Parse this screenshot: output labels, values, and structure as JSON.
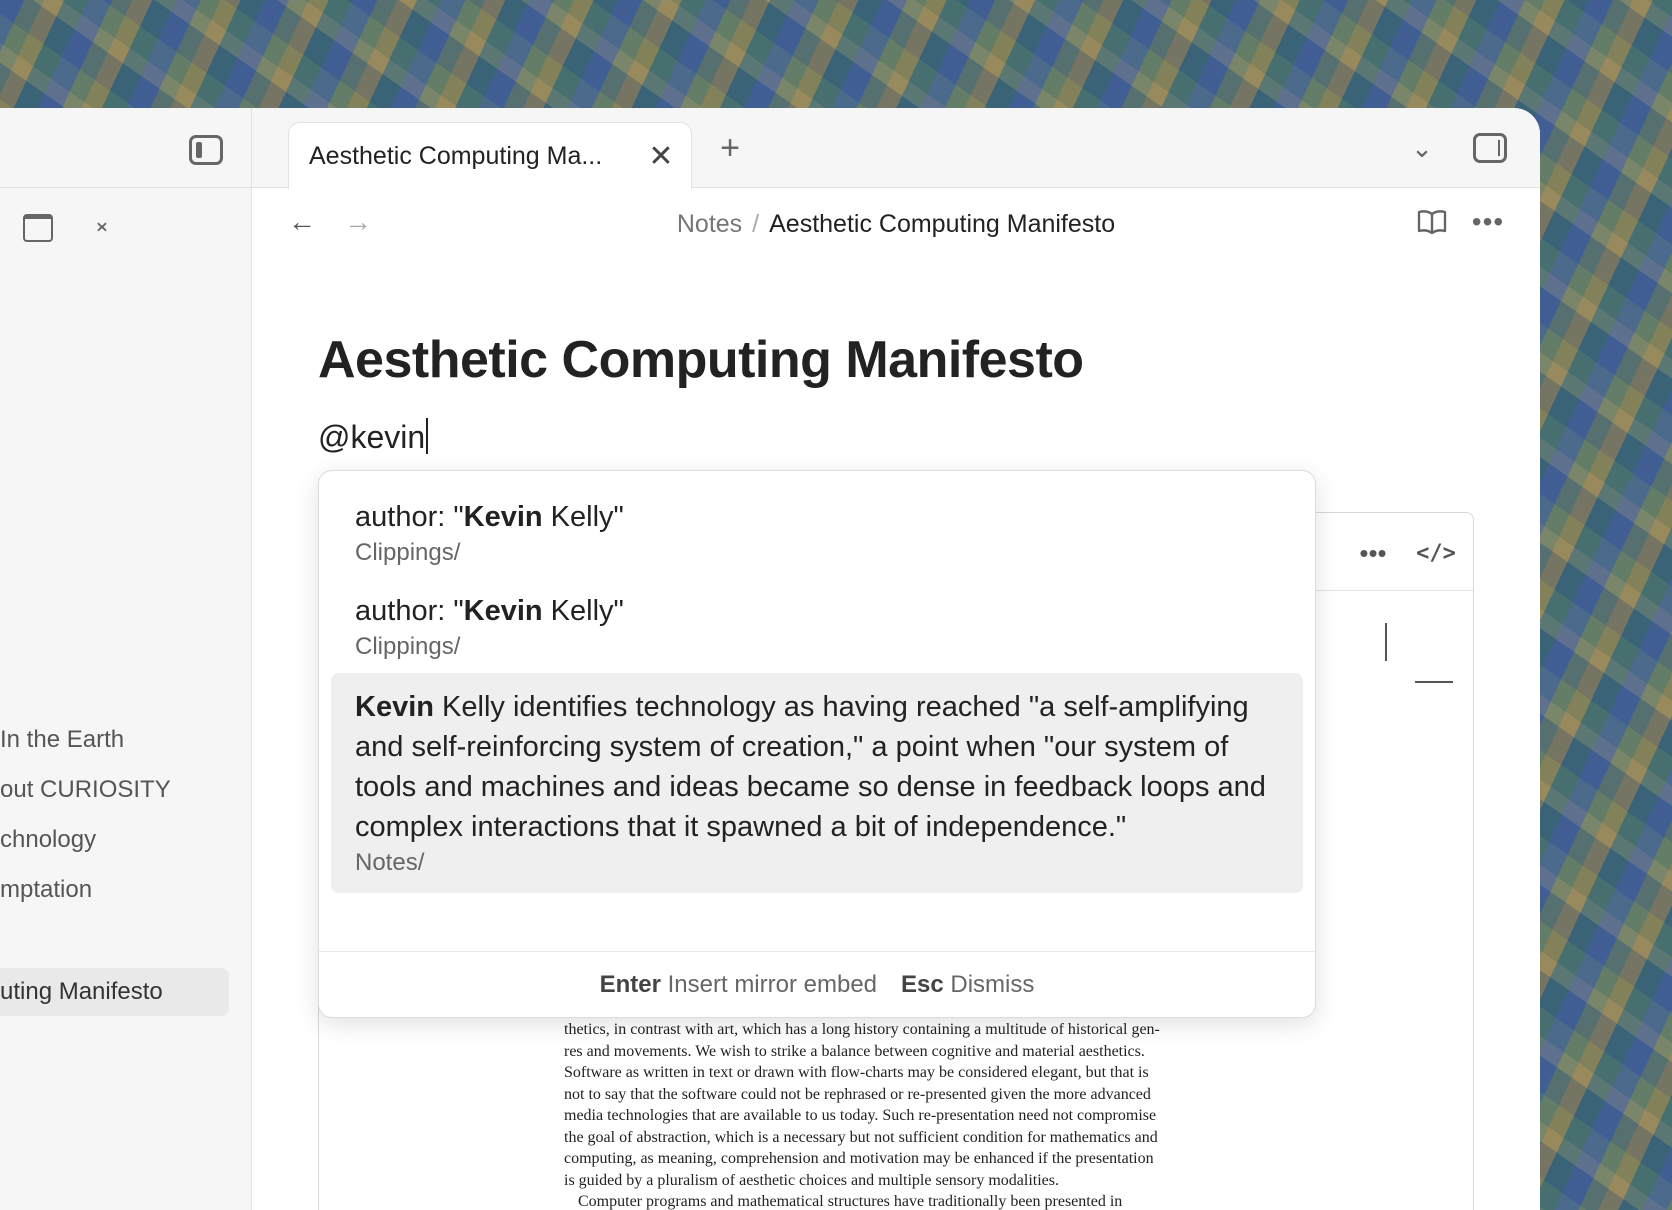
{
  "tab": {
    "title": "Aesthetic Computing Ma...",
    "close_glyph": "✕",
    "new_glyph": "+"
  },
  "breadcrumb": {
    "folder": "Notes",
    "separator": "/",
    "note": "Aesthetic Computing Manifesto"
  },
  "note": {
    "title": "Aesthetic Computing Manifesto",
    "typed_text": "@kevin"
  },
  "sidebar": {
    "items": [
      {
        "label": "In the Earth"
      },
      {
        "label": "out CURIOSITY"
      },
      {
        "label": "chnology"
      },
      {
        "label": "mptation"
      },
      {
        "label": "uting Manifesto"
      }
    ]
  },
  "suggestions": [
    {
      "prefix": "author: \"",
      "match": "Kevin",
      "suffix": " Kelly\"",
      "path": "Clippings/"
    },
    {
      "prefix": "author: \"",
      "match": "Kevin",
      "suffix": " Kelly\"",
      "path": "Clippings/"
    },
    {
      "prefix": "",
      "match": "Kevin",
      "suffix": " Kelly identifies technology as having reached \"a self-amplifying and self-reinforcing system of creation,\" a point when \"our system of tools and machines and ideas became so dense in feedback loops and complex interactions that it spawned a bit of independence.\"",
      "path": "Notes/"
    }
  ],
  "footer": {
    "enter_key": "Enter",
    "enter_action": "Insert mirror embed",
    "esc_key": "Esc",
    "esc_action": "Dismiss"
  },
  "pdf_lines": [
    "thetics, in contrast with art, which has a long history containing a multitude of historical gen-",
    "res and movements. We wish to strike a balance between cognitive and material aesthetics.",
    "Software as written in text or drawn with flow-charts may be considered elegant, but that is",
    "not to say that the software could not be rephrased or re-presented given the more advanced",
    "media technologies that are available to us today. Such re-presentation need not compromise",
    "the goal of abstraction, which is a necessary but not sufficient condition for mathematics and",
    "computing, as meaning, comprehension and motivation may be enhanced if the presentation",
    "is guided by a pluralism of aesthetic choices and multiple sensory modalities.",
    "Computer programs and mathematical structures have traditionally been presented in"
  ],
  "icons": {
    "back": "←",
    "forward": "→",
    "chevron": "⌄",
    "more": "•••",
    "code": "</>",
    "reading": "📖",
    "collapse": "✕"
  },
  "colors": {
    "selected_bg": "#efefef",
    "sidebar_bg": "#f6f6f6"
  }
}
